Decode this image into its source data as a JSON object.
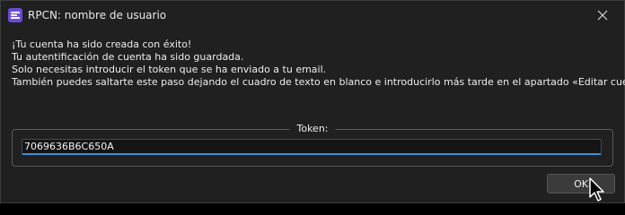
{
  "window": {
    "title": "RPCN: nombre de usuario",
    "app_icon": "rpcn-app-icon",
    "close_icon": "close-icon"
  },
  "message": {
    "lines": [
      "¡Tu cuenta ha sido creada con éxito!",
      "Tu autentificación de cuenta ha sido guardada.",
      "Solo necesitas introducir el token que se ha enviado a tu email.",
      "También puedes saltarte este paso dejando el cuadro de texto en blanco e introducirlo más tarde en el apartado «Editar cuenta»."
    ]
  },
  "token": {
    "label": "Token:",
    "value": "7069636B6C650A"
  },
  "buttons": {
    "ok_label": "OK"
  },
  "colors": {
    "window_bg": "#202020",
    "accent": "#3b8fd6",
    "app_icon": "#6a4bd8"
  }
}
